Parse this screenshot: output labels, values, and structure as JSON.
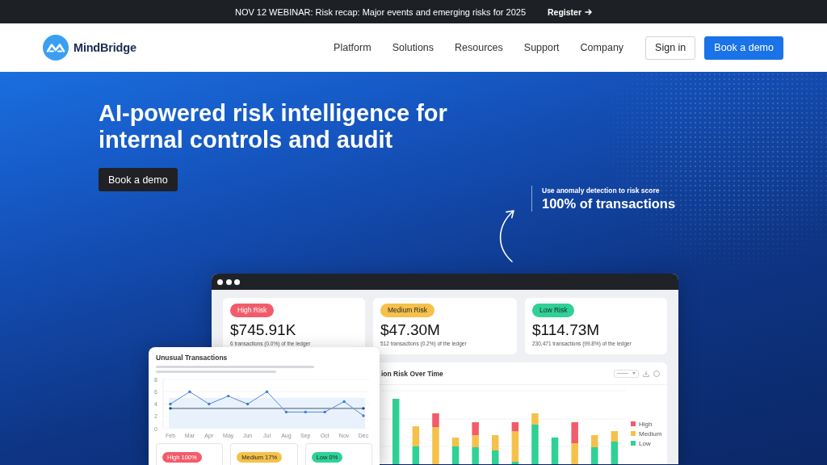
{
  "announcement": {
    "text": "NOV 12 WEBINAR: Risk recap: Major events and emerging risks for 2025",
    "link": "Register"
  },
  "header": {
    "logo": "MindBridge",
    "nav": [
      "Platform",
      "Solutions",
      "Resources",
      "Support",
      "Company"
    ],
    "buttons": [
      {
        "label": "Sign in",
        "kind": "outline"
      },
      {
        "label": "Book a demo",
        "kind": "primary"
      }
    ]
  },
  "hero": {
    "title": "AI-powered risk intelligence for internal controls and audit",
    "button": "Book a demo",
    "callout": {
      "caption": "Use anomaly detection to risk score",
      "headline": "100% of transactions"
    }
  },
  "dashboard": {
    "risk_cards": [
      {
        "badge": "High Risk",
        "color": "#f25c6a",
        "amount": "$745.91K",
        "detail": "6 transactions (0.0%) of the ledger"
      },
      {
        "badge": "Medium Risk",
        "color": "#f5c14b",
        "amount": "$47.30M",
        "detail": "512 transactions (0.2%) of the ledger"
      },
      {
        "badge": "Low Risk",
        "color": "#2fd196",
        "amount": "$114.73M",
        "detail": "230,471 transactions (99.8%) of the ledger"
      }
    ],
    "risk_chart": {
      "title": "ion Risk Over Time",
      "legend": [
        {
          "label": "High",
          "color": "#f25c6a"
        },
        {
          "label": "Medium",
          "color": "#f5c14b"
        },
        {
          "label": "Low",
          "color": "#2fd196"
        }
      ]
    },
    "unusual": {
      "title": "Unusual Transactions",
      "chart_data": {
        "type": "line",
        "categories": [
          "Feb",
          "Mar",
          "Apr",
          "May",
          "Jun",
          "Jul",
          "Aug",
          "Sep",
          "Oct",
          "Nov",
          "Dec"
        ],
        "series": [
          {
            "color": "#3b7dd8",
            "values": [
              4,
              6,
              4,
              5.3,
              4,
              6,
              2.7,
              2.7,
              2.7,
              4.4,
              2.1
            ]
          },
          {
            "color": "#8e98a8",
            "values": [
              3.3,
              3.3,
              3.3,
              3.3,
              3.3,
              3.3,
              3.3,
              3.3,
              3.3,
              3.3,
              3.3
            ]
          }
        ],
        "ylim": [
          0,
          8
        ],
        "yticks": [
          0,
          2,
          4,
          6,
          8
        ],
        "grid": true,
        "bands": [
          {
            "axis": "y",
            "from": 0,
            "to": 5
          }
        ]
      },
      "badges": [
        {
          "label": "High 100%",
          "color": "#f25c6a"
        },
        {
          "label": "Medium 17%",
          "color": "#f5c14b"
        },
        {
          "label": "Low 0%",
          "color": "#2fd196"
        }
      ]
    }
  }
}
